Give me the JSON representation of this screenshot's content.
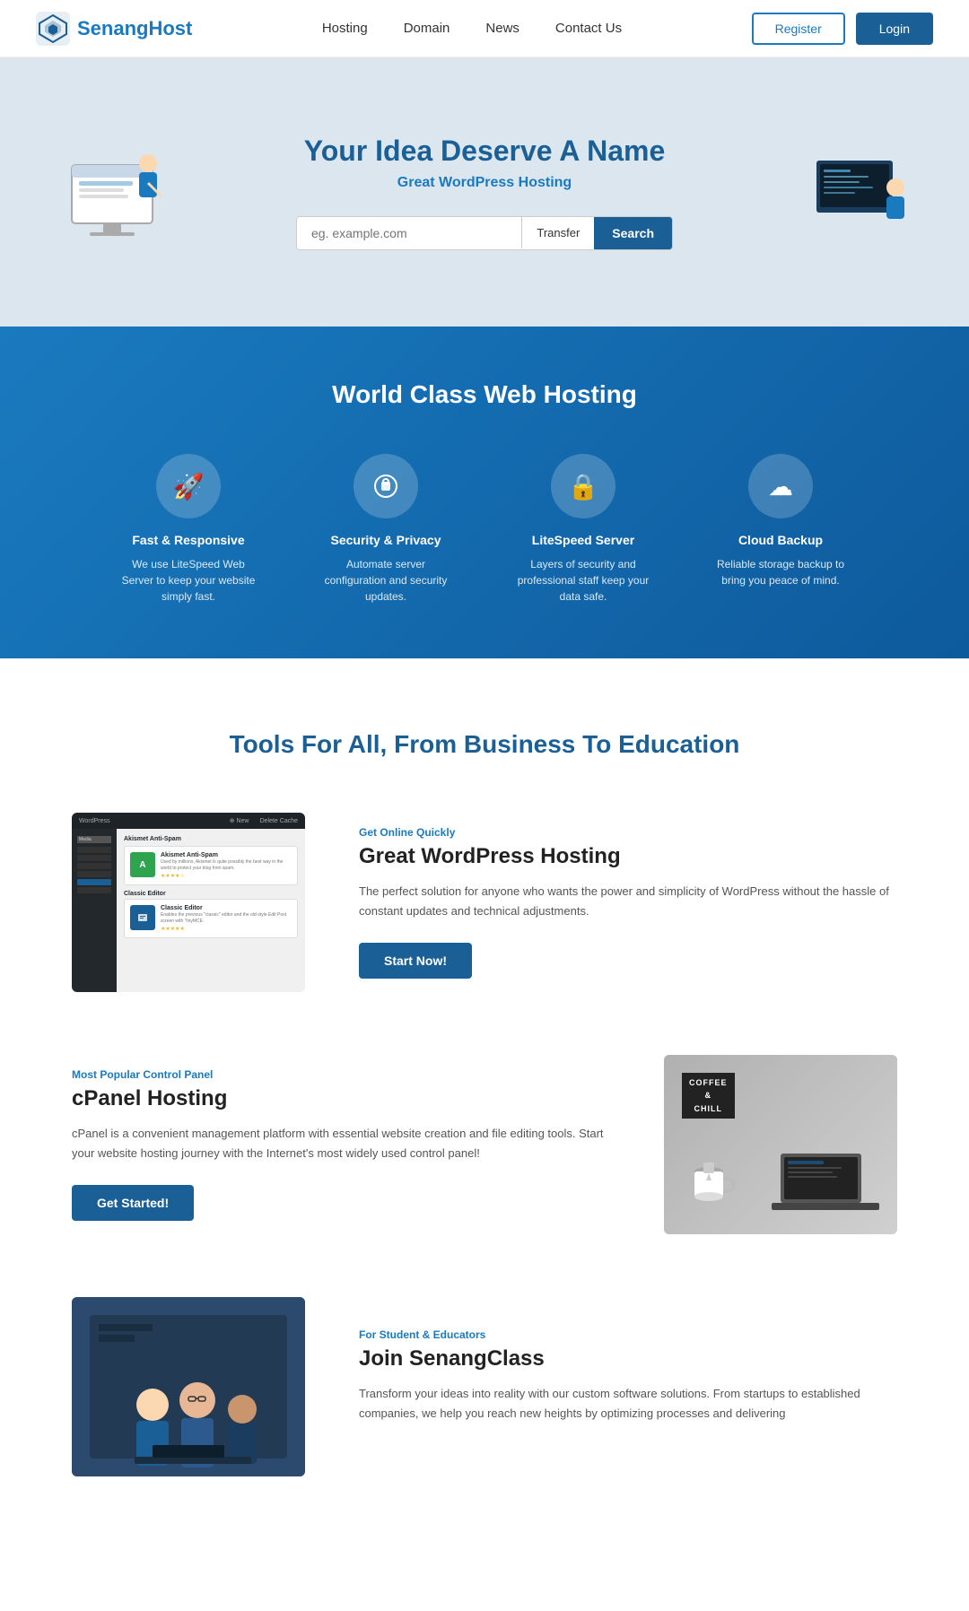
{
  "brand": {
    "name_black": "Senang",
    "name_blue": "Host",
    "logo_alt": "SenangHost Logo"
  },
  "navbar": {
    "links": [
      {
        "label": "Hosting",
        "id": "hosting"
      },
      {
        "label": "Domain",
        "id": "domain"
      },
      {
        "label": "News",
        "id": "news"
      },
      {
        "label": "Contact Us",
        "id": "contact"
      }
    ],
    "register_label": "Register",
    "login_label": "Login"
  },
  "hero": {
    "title": "Your Idea Deserve A Name",
    "subtitle": "Great WordPress Hosting",
    "search_placeholder": "eg. example.com",
    "transfer_label": "Transfer",
    "search_label": "Search"
  },
  "features": {
    "title": "World Class Web Hosting",
    "items": [
      {
        "icon": "🚀",
        "name": "Fast & Responsive",
        "desc": "We use LiteSpeed Web Server to keep your website simply fast."
      },
      {
        "icon": "🛡",
        "name": "Security & Privacy",
        "desc": "Automate server configuration and security updates."
      },
      {
        "icon": "🔒",
        "name": "LiteSpeed Server",
        "desc": "Layers of security and professional staff keep your data safe."
      },
      {
        "icon": "☁",
        "name": "Cloud Backup",
        "desc": "Reliable storage backup to bring you peace of mind."
      }
    ]
  },
  "tools": {
    "section_title": "Tools For All, From Business To Education",
    "wordpress": {
      "tag": "Get Online Quickly",
      "heading": "Great WordPress Hosting",
      "desc": "The perfect solution for anyone who wants the power and simplicity of WordPress without the hassle of constant updates and technical adjustments.",
      "button": "Start Now!"
    },
    "cpanel": {
      "tag": "Most Popular Control Panel",
      "heading": "cPanel Hosting",
      "desc": "cPanel is a convenient management platform with essential website creation and file editing tools. Start your website hosting journey with the Internet's most widely used control panel!",
      "button": "Get Started!",
      "image_text": "COFFEE\n&\nCHILL"
    },
    "education": {
      "tag": "For Student & Educators",
      "heading": "Join SenangClass",
      "desc": "Transform your ideas into reality with our custom software solutions. From startups to established companies, we help you reach new heights by optimizing processes and delivering"
    }
  }
}
